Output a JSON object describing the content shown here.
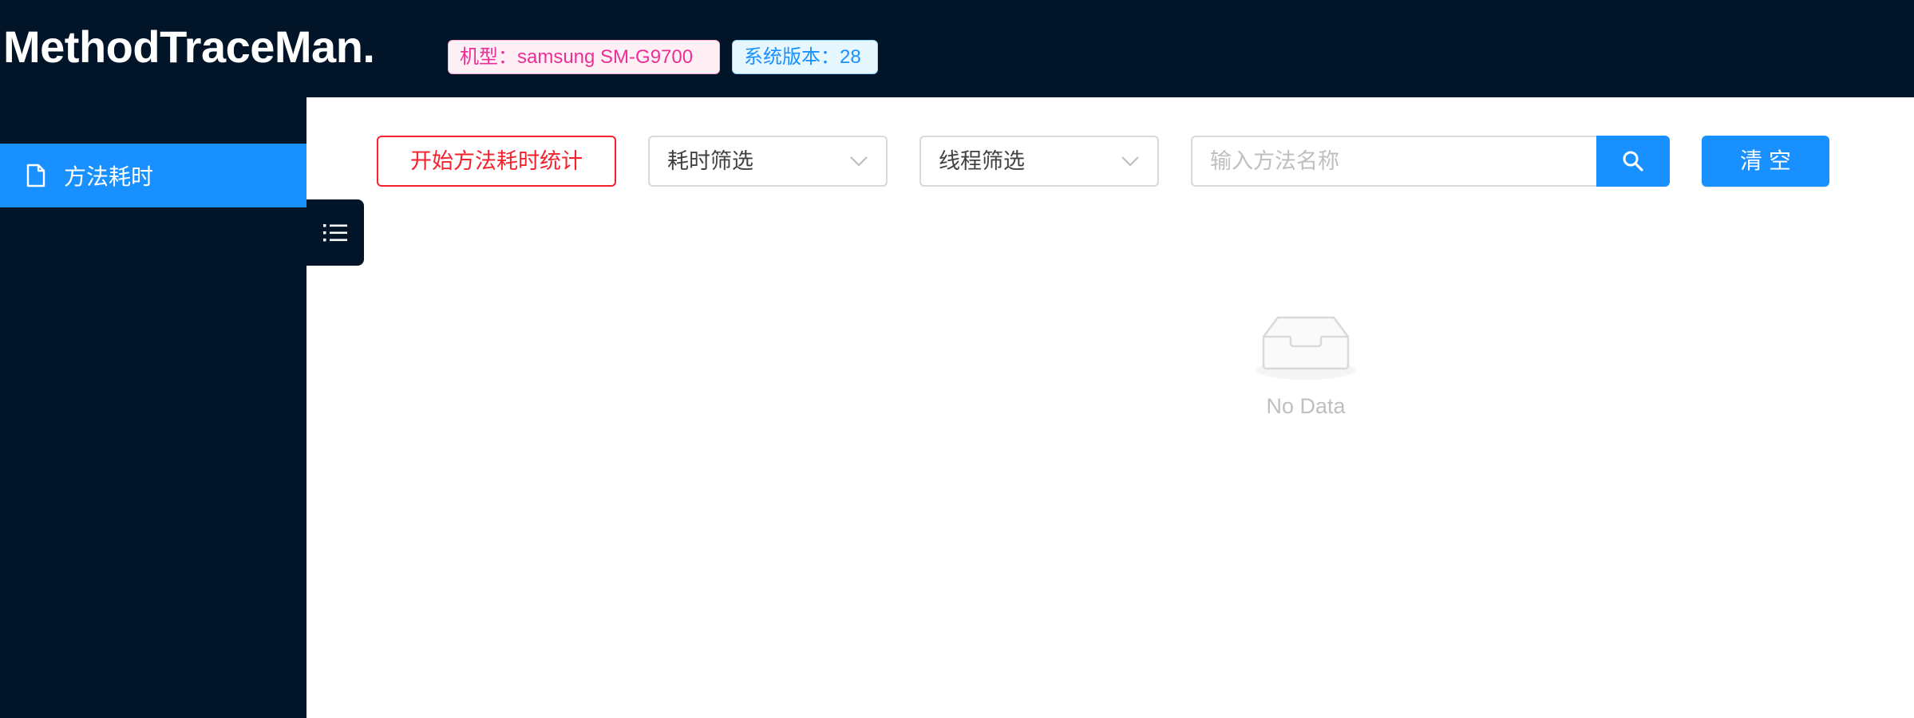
{
  "header": {
    "title": "MethodTraceMan.",
    "model_tag": "机型：samsung SM-G9700",
    "version_tag": "系统版本：28"
  },
  "sidebar": {
    "items": [
      {
        "label": "方法耗时",
        "icon": "file-icon",
        "selected": true
      }
    ],
    "collapse_icon": "menu-unfold-icon"
  },
  "toolbar": {
    "start_label": "开始方法耗时统计",
    "duration_filter": {
      "value": "耗时筛选",
      "icon": "chevron-down-icon"
    },
    "thread_filter": {
      "value": "线程筛选",
      "icon": "chevron-down-icon"
    },
    "search": {
      "placeholder": "输入方法名称",
      "value": "",
      "icon": "search-icon"
    },
    "clear_label": "清空"
  },
  "empty": {
    "text": "No Data",
    "icon": "empty-inbox-icon"
  },
  "colors": {
    "dark_bg": "#011428",
    "primary": "#1890ff",
    "danger": "#f5222d",
    "magenta": "#eb2f96"
  }
}
